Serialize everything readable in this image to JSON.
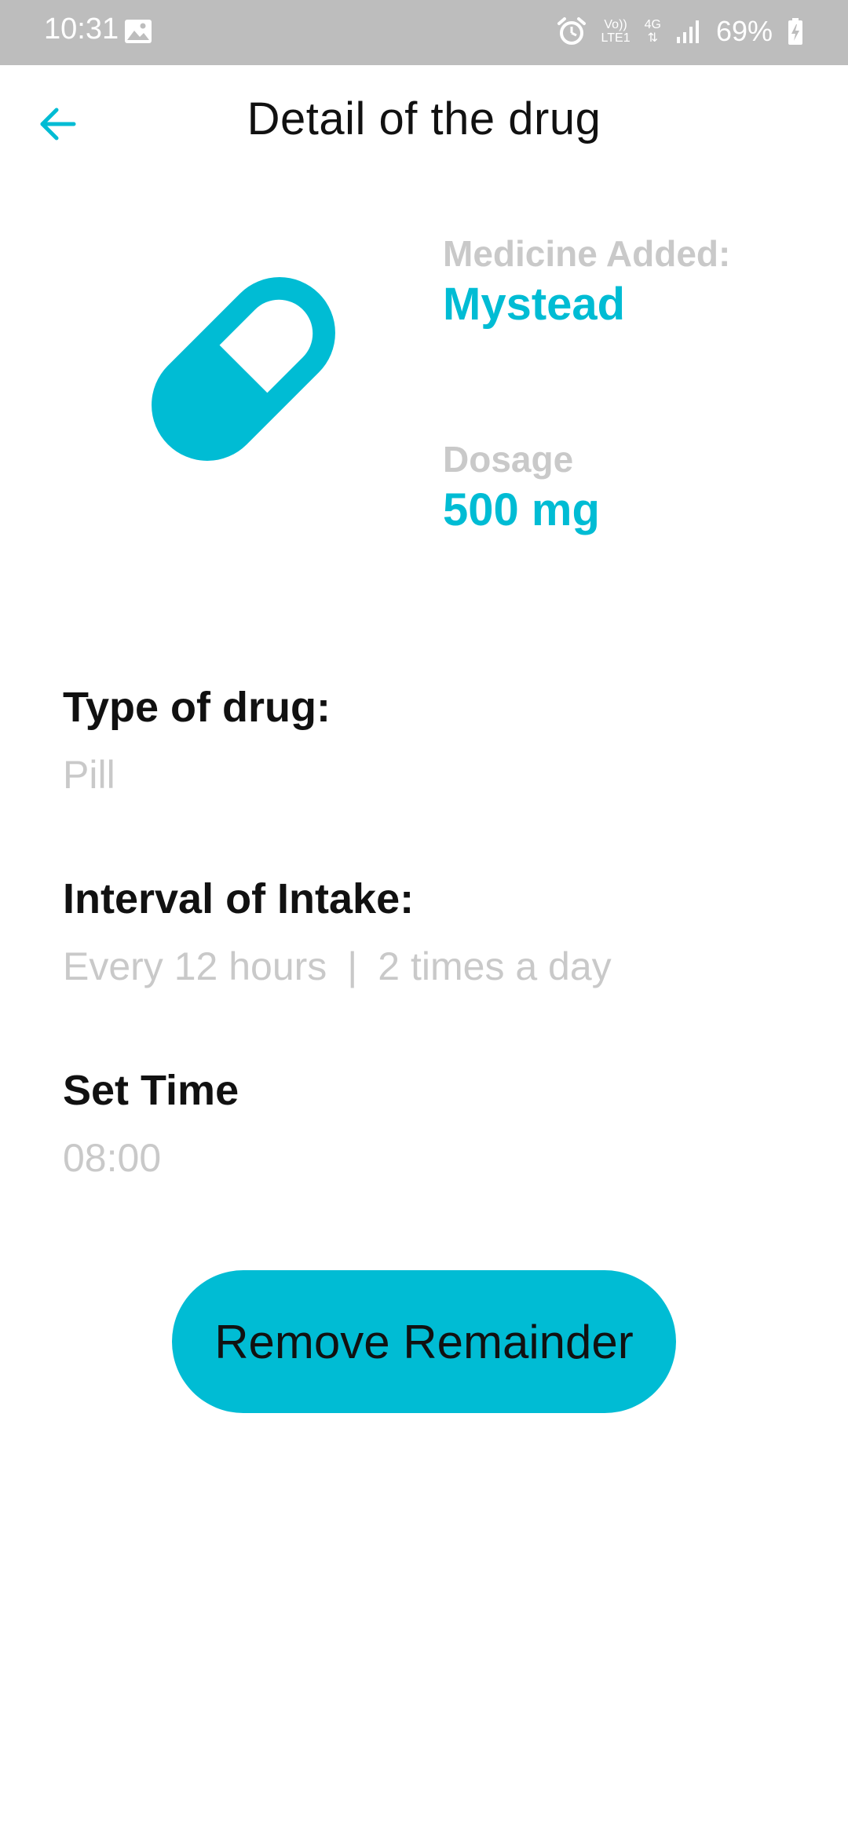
{
  "status_bar": {
    "time": "10:31",
    "volte_top": "Vo))",
    "volte_bottom": "LTE1",
    "network": "4G",
    "battery": "69%",
    "icons": [
      "gallery-icon",
      "alarm-icon",
      "signal-icon",
      "battery-charging-icon"
    ]
  },
  "header": {
    "title": "Detail of the drug",
    "back_icon": "arrow-left-icon"
  },
  "summary": {
    "medicine_label": "Medicine Added:",
    "medicine_name": "Mystead",
    "dosage_label": "Dosage",
    "dosage_value": "500 mg",
    "illustration": "pill-icon"
  },
  "details": {
    "type_heading": "Type of drug:",
    "type_value": "Pill",
    "interval_heading": "Interval of Intake:",
    "interval_hours": "Every 12 hours",
    "interval_separator": "|",
    "interval_times": "2 times a day",
    "time_heading": "Set Time",
    "time_value": "08:00"
  },
  "actions": {
    "remove_label": "Remove Remainder"
  },
  "colors": {
    "accent": "#00bcd4",
    "muted_text": "#c9c9c9",
    "status_bar": "#bdbdbd"
  }
}
